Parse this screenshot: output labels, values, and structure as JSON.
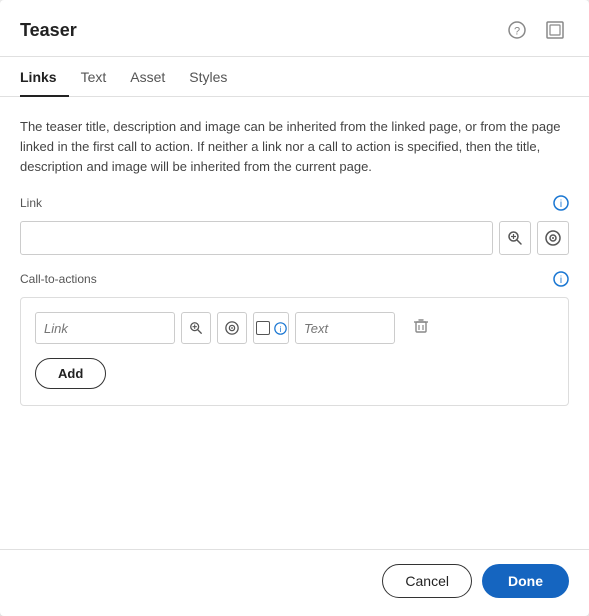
{
  "dialog": {
    "title": "Teaser",
    "tabs": [
      {
        "id": "links",
        "label": "Links",
        "active": true
      },
      {
        "id": "text",
        "label": "Text",
        "active": false
      },
      {
        "id": "asset",
        "label": "Asset",
        "active": false
      },
      {
        "id": "styles",
        "label": "Styles",
        "active": false
      }
    ],
    "description": "The teaser title, description and image can be inherited from the linked page, or from the page linked in the first call to action. If neither a link nor a call to action is specified, then the title, description and image will be inherited from the current page.",
    "link_section": {
      "label": "Link",
      "input_placeholder": ""
    },
    "cta_section": {
      "label": "Call-to-actions",
      "cta_link_placeholder": "Link",
      "cta_text_placeholder": "Text"
    },
    "buttons": {
      "add": "Add",
      "cancel": "Cancel",
      "done": "Done"
    },
    "icons": {
      "help": "?",
      "expand": "⤢",
      "info": "ℹ",
      "search_pick": "🔍",
      "circle_pick": "⊙",
      "trash": "🗑"
    }
  }
}
